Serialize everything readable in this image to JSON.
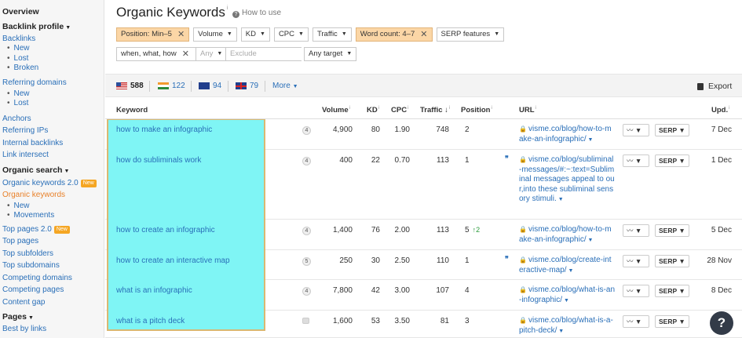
{
  "sidebar": {
    "overview": "Overview",
    "backlink_profile": "Backlink profile",
    "backlinks": "Backlinks",
    "backlinks_sub": [
      "New",
      "Lost",
      "Broken"
    ],
    "referring_domains": "Referring domains",
    "referring_domains_sub": [
      "New",
      "Lost"
    ],
    "anchors": "Anchors",
    "referring_ips": "Referring IPs",
    "internal_backlinks": "Internal backlinks",
    "link_intersect": "Link intersect",
    "organic_search": "Organic search",
    "organic_keywords_2": "Organic keywords 2.0",
    "new_badge": "New",
    "organic_keywords": "Organic keywords",
    "organic_keywords_sub": [
      "New",
      "Movements"
    ],
    "top_pages_2": "Top pages 2.0",
    "top_pages": "Top pages",
    "top_subfolders": "Top subfolders",
    "top_subdomains": "Top subdomains",
    "competing_domains": "Competing domains",
    "competing_pages": "Competing pages",
    "content_gap": "Content gap",
    "pages": "Pages",
    "best_by_links": "Best by links"
  },
  "header": {
    "title": "Organic Keywords",
    "title_info": "i",
    "how_to_use": "How to use"
  },
  "filters": {
    "position": "Position: Min–5",
    "volume": "Volume",
    "kd": "KD",
    "cpc": "CPC",
    "traffic": "Traffic",
    "word_count": "Word count: 4–7",
    "serp_features": "SERP features",
    "include_value": "when, what, how",
    "any_label": "Any",
    "exclude_placeholder": "Exclude",
    "any_target": "Any target"
  },
  "countries": [
    {
      "flag": "us",
      "count": "588"
    },
    {
      "flag": "in",
      "count": "122"
    },
    {
      "flag": "au",
      "count": "94"
    },
    {
      "flag": "gb",
      "count": "79"
    }
  ],
  "more_label": "More",
  "export_label": "Export",
  "table": {
    "headers": {
      "keyword": "Keyword",
      "volume": "Volume",
      "kd": "KD",
      "cpc": "CPC",
      "traffic": "Traffic",
      "position": "Position",
      "url": "URL",
      "updated": "Upd."
    },
    "rows": [
      {
        "keyword": "how to make an infographic",
        "sf": "4",
        "volume": "4,900",
        "kd": "80",
        "cpc": "1.90",
        "traffic": "748",
        "position": "2",
        "change": "",
        "feat": "",
        "url": "visme.co/blog/how-to-make-an-infographic/",
        "serp": "SERP",
        "updated": "7 Dec"
      },
      {
        "keyword": "how do subliminals work",
        "sf": "4",
        "volume": "400",
        "kd": "22",
        "cpc": "0.70",
        "traffic": "113",
        "position": "1",
        "change": "",
        "feat": "❞",
        "url": "visme.co/blog/subliminal-messages/#:~:text=Subliminal messages appeal to our,into these subliminal sensory stimuli.",
        "serp": "SERP",
        "updated": "1 Dec"
      },
      {
        "keyword": "how to create an infographic",
        "sf": "4",
        "volume": "1,400",
        "kd": "76",
        "cpc": "2.00",
        "traffic": "113",
        "position": "5",
        "change": "2",
        "feat": "",
        "url": "visme.co/blog/how-to-make-an-infographic/",
        "serp": "SERP",
        "updated": "5 Dec"
      },
      {
        "keyword": "how to create an interactive map",
        "sf": "5",
        "volume": "250",
        "kd": "30",
        "cpc": "2.50",
        "traffic": "110",
        "position": "1",
        "change": "",
        "feat": "❞",
        "url": "visme.co/blog/create-interactive-map/",
        "serp": "SERP",
        "updated": "28 Nov"
      },
      {
        "keyword": "what is an infographic",
        "sf": "4",
        "volume": "7,800",
        "kd": "42",
        "cpc": "3.00",
        "traffic": "107",
        "position": "4",
        "change": "",
        "feat": "",
        "url": "visme.co/blog/what-is-an-infographic/",
        "serp": "SERP",
        "updated": "8 Dec"
      },
      {
        "keyword": "what is a pitch deck",
        "sf": "",
        "volume": "1,600",
        "kd": "53",
        "cpc": "3.50",
        "traffic": "81",
        "position": "3",
        "change": "",
        "feat": "",
        "url": "visme.co/blog/what-is-a-pitch-deck/",
        "serp": "SERP",
        "updated": "9 Dec"
      }
    ]
  },
  "help_label": "?"
}
